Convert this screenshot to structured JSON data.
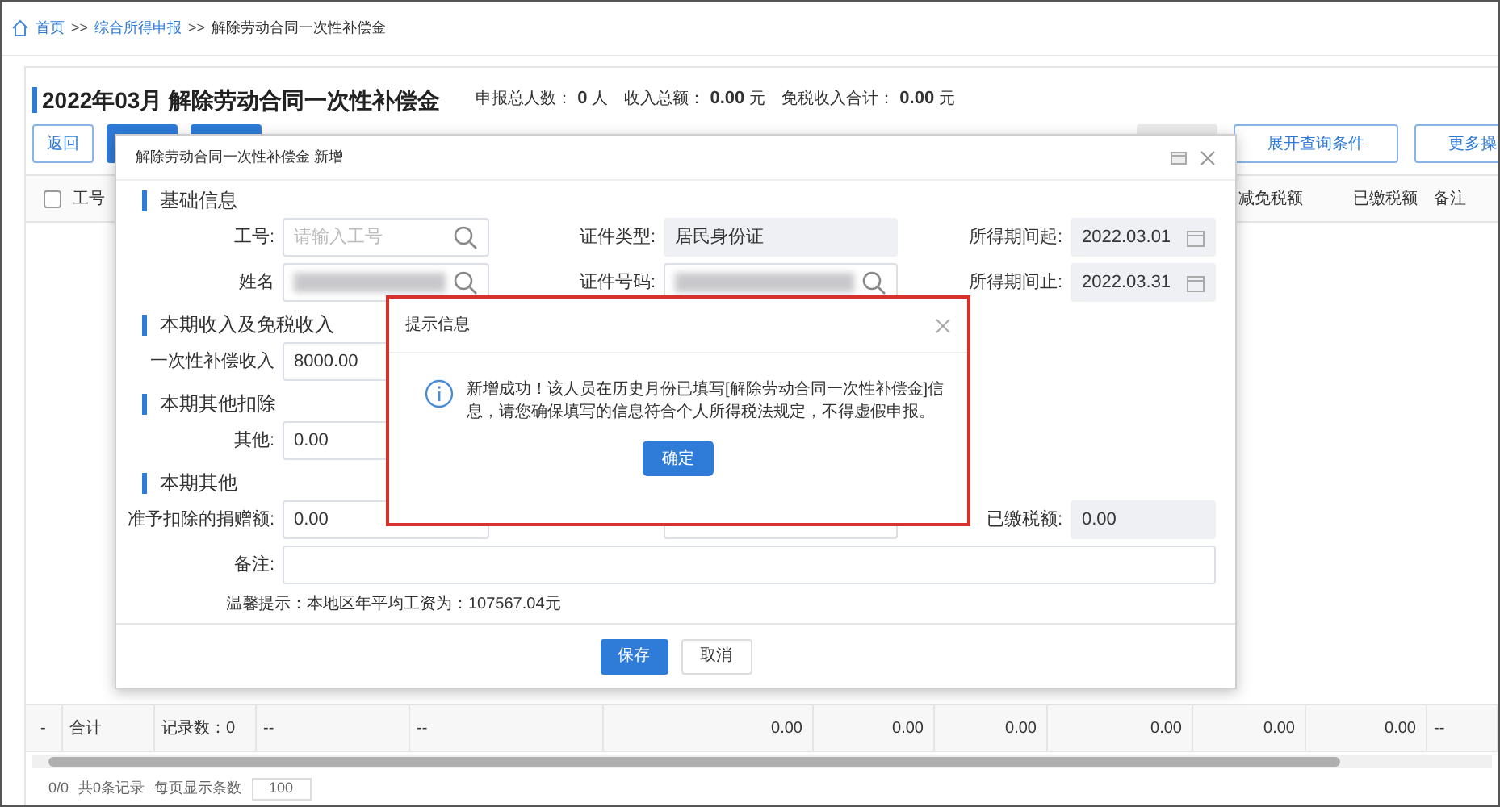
{
  "breadcrumb": [
    {
      "kind": "link",
      "text": "首页"
    },
    {
      "kind": "separator",
      "text": ">>"
    },
    {
      "kind": "link",
      "text": "综合所得申报"
    },
    {
      "kind": "separator",
      "text": ">>"
    },
    {
      "kind": "current",
      "text": "解除劳动合同一次性补偿金"
    }
  ],
  "header": {
    "title": "2022年03月 解除劳动合同一次性补偿金",
    "stats": [
      {
        "label": "申报总人数：",
        "value": "0",
        "unit": "人"
      },
      {
        "label": "收入总额：",
        "value": "0.00",
        "unit": "元"
      },
      {
        "label": "免税收入合计：",
        "value": "0.00",
        "unit": "元"
      }
    ]
  },
  "toolbar": {
    "left": [
      {
        "kind": "outline",
        "label": "返回"
      },
      {
        "kind": "primary"
      },
      {
        "kind": "primary"
      }
    ],
    "right": [
      {
        "kind": "grey"
      },
      {
        "kind": "outline",
        "label": "展开查询条件"
      },
      {
        "kind": "outline",
        "label": "更多操"
      }
    ]
  },
  "table": {
    "columns": [
      {
        "kind": "checkbox",
        "checked": false
      },
      {
        "kind": "text",
        "label": "工号"
      },
      {
        "kind": "hidden"
      },
      {
        "kind": "hidden"
      },
      {
        "kind": "hidden"
      },
      {
        "kind": "hidden"
      },
      {
        "kind": "hidden"
      },
      {
        "kind": "hidden"
      },
      {
        "kind": "hidden"
      },
      {
        "kind": "text",
        "label": "减免税额"
      },
      {
        "kind": "text",
        "label": "已缴税额"
      },
      {
        "kind": "text",
        "label": "备注"
      }
    ],
    "total_row": [
      "-",
      "合计",
      "记录数：0",
      "--",
      "--",
      "0.00",
      "0.00",
      "0.00",
      "0.00",
      "0.00",
      "0.00",
      "--"
    ]
  },
  "pagination": {
    "pages": "0/0",
    "records": "共0条记录",
    "page_size_label": "每页显示条数",
    "page_size": "100"
  },
  "dialog": {
    "title": "解除劳动合同一次性补偿金 新增",
    "sections": [
      {
        "title": "基础信息",
        "rows": [
          [
            {
              "kind": "search",
              "label": "工号:",
              "placeholder": "请输入工号"
            },
            {
              "kind": "text",
              "label": "证件类型:",
              "value": "居民身份证",
              "disabled": true
            },
            {
              "kind": "date",
              "label": "所得期间起:",
              "value": "2022.03.01",
              "disabled": true
            }
          ],
          [
            {
              "kind": "redacted",
              "label": "姓名"
            },
            {
              "kind": "redacted",
              "label": "证件号码:"
            },
            {
              "kind": "date",
              "label": "所得期间止:",
              "value": "2022.03.31",
              "disabled": true
            }
          ]
        ]
      },
      {
        "title": "本期收入及免税收入",
        "rows": [
          [
            {
              "kind": "text",
              "label": "一次性补偿收入",
              "value": "8000.00"
            }
          ]
        ]
      },
      {
        "title": "本期其他扣除",
        "rows": [
          [
            {
              "kind": "text",
              "label": "其他:",
              "value": "0.00"
            }
          ]
        ]
      },
      {
        "title": "本期其他",
        "rows": [
          [
            {
              "kind": "text",
              "label": "准予扣除的捐赠额:",
              "value": "0.00"
            },
            {
              "kind": "covered"
            },
            {
              "kind": "text",
              "label": "已缴税额:",
              "value": "0.00",
              "disabled": true
            }
          ],
          [
            {
              "kind": "wide",
              "label": "备注:"
            }
          ]
        ]
      }
    ],
    "hint": "温馨提示：本地区年平均工资为：107567.04元",
    "buttons": [
      {
        "kind": "primary",
        "label": "保存"
      },
      {
        "kind": "default",
        "label": "取消"
      }
    ]
  },
  "alert": {
    "title": "提示信息",
    "message": "新增成功！该人员在历史月份已填写[解除劳动合同一次性补偿金]信息，请您确保填写的信息符合个人所得税法规定，不得虚假申报。",
    "button": "确定"
  }
}
